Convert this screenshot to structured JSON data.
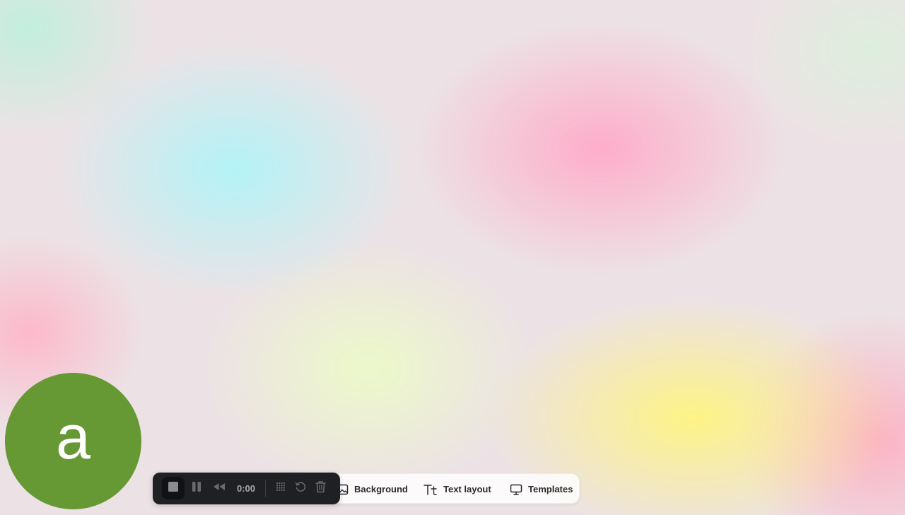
{
  "avatar": {
    "letter": "a",
    "color": "#669933"
  },
  "recorder": {
    "timer": "0:00",
    "icons": [
      "stop-icon",
      "pause-icon",
      "rewind-icon",
      "grid-icon",
      "reset-icon",
      "trash-icon"
    ]
  },
  "toolbar": {
    "background_label": "Background",
    "text_layout_label": "Text layout",
    "templates_label": "Templates",
    "icons": [
      "image-icon",
      "text-format-icon",
      "monitor-icon"
    ]
  },
  "colors": {
    "dark_bar": "#1f2023",
    "light_bar": "#ffffff",
    "gradient": [
      "#b0f4f8",
      "#ffaac8",
      "#fff480",
      "#ecfac8"
    ]
  }
}
